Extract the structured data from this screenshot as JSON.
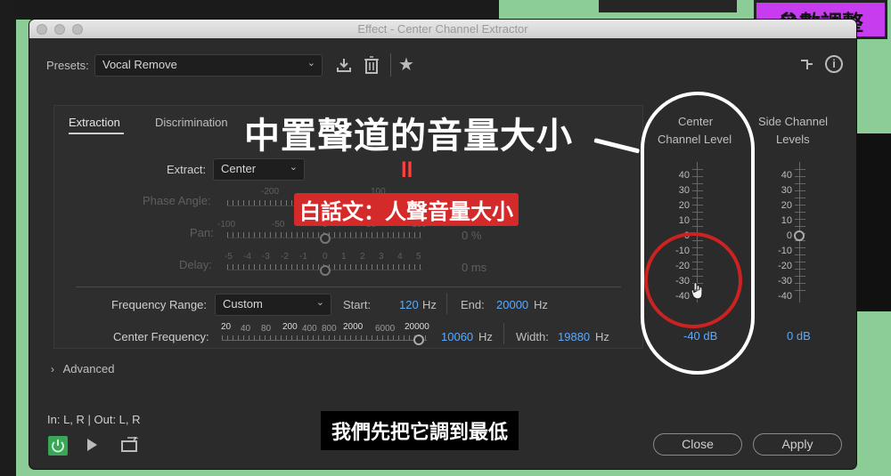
{
  "window": {
    "title": "Effect - Center Channel Extractor"
  },
  "badge": {
    "label": "參數調整"
  },
  "presets": {
    "label": "Presets:",
    "value": "Vocal Remove"
  },
  "tabs": {
    "extraction": "Extraction",
    "discrimination": "Discrimination"
  },
  "extract": {
    "label": "Extract:",
    "value": "Center"
  },
  "phase": {
    "label": "Phase Angle:",
    "tick1": "-200",
    "tick2": "100"
  },
  "pan": {
    "label": "Pan:",
    "ticks": [
      "-100",
      "-50",
      "0",
      "50",
      "100"
    ],
    "value": "0 %"
  },
  "delay": {
    "label": "Delay:",
    "ticks": [
      "-5",
      "-4",
      "-3",
      "-2",
      "-1",
      "0",
      "1",
      "2",
      "3",
      "4",
      "5"
    ],
    "value": "0 ms"
  },
  "freq_range": {
    "label": "Frequency Range:",
    "value": "Custom",
    "start_label": "Start:",
    "start_value": "120",
    "start_unit": "Hz",
    "end_label": "End:",
    "end_value": "20000",
    "end_unit": "Hz"
  },
  "center_freq": {
    "label": "Center Frequency:",
    "ticks": [
      "20",
      "40",
      "80",
      "200",
      "400",
      "800",
      "2000",
      "6000",
      "20000"
    ],
    "value": "10060",
    "unit": "Hz",
    "width_label": "Width:",
    "width_value": "19880",
    "width_unit": "Hz",
    "level": 0.96
  },
  "center_meter": {
    "title1": "Center",
    "title2": "Channel Level",
    "scale": [
      "40",
      "30",
      "20",
      "10",
      "0",
      "-10",
      "-20",
      "-30",
      "-40"
    ],
    "value": "-40 dB"
  },
  "side_meter": {
    "title1": "Side Channel",
    "title2": "Levels",
    "scale": [
      "40",
      "30",
      "20",
      "10",
      "0",
      "-10",
      "-20",
      "-30",
      "-40"
    ],
    "value": "0 dB"
  },
  "advanced": {
    "label": "Advanced"
  },
  "io": {
    "label": "In: L, R | Out: L, R"
  },
  "buttons": {
    "close": "Close",
    "apply": "Apply"
  },
  "overlay": {
    "headline": "中置聲道的音量大小",
    "equals": "ll",
    "subline": "白話文：人聲音量大小",
    "caption": "我們先把它調到最低"
  },
  "colors": {
    "accent": "#5aa9ff",
    "badge": "#c83cf0",
    "annotation": "#cc2222",
    "power": "#3aa657"
  }
}
